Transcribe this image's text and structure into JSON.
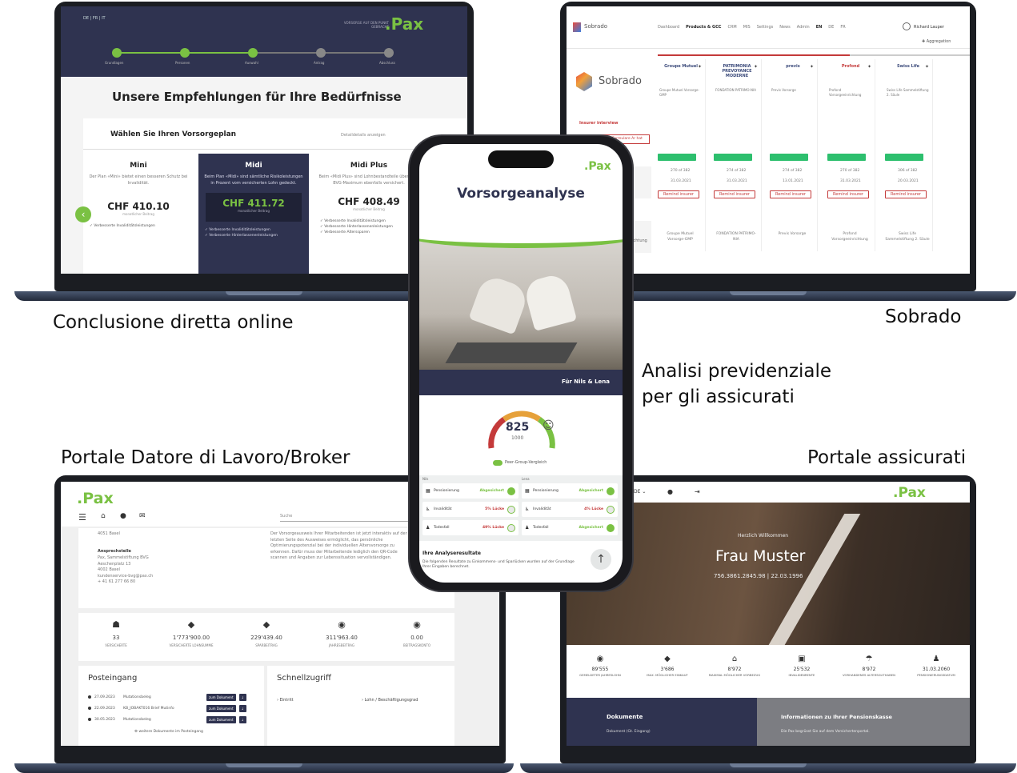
{
  "captions": {
    "top_left": "Conclusione diretta online",
    "top_right": "Sobrado",
    "middle": [
      "Analisi previdenziale",
      "per gli assicurati"
    ],
    "bottom_left": "Portale Datore di Lavoro/Broker",
    "bottom_right": "Portale assicurati"
  },
  "colors": {
    "navy": "#2f3350",
    "green": "#7ac143",
    "accent_green": "#2dbf6e",
    "red": "#c43a3a"
  },
  "pax_onboarding": {
    "logo": ".Pax",
    "lang": "DE | FR | IT",
    "tagline": "VORSORGE AUF DEN PUNKT GEBRACHT",
    "steps": [
      "Grundlagen",
      "Personen",
      "Auswahl",
      "Antrag",
      "Abschluss"
    ],
    "heading": "Unsere Empfehlungen für Ihre Bedürfnisse",
    "subheading": "Wählen Sie Ihren Vorsorgeplan",
    "compare_link": "Detaildetails anzeigen",
    "plans": [
      {
        "name": "Mini",
        "desc": "Der Plan «Mini» bietet einen besseren Schutz bei Invalidität.",
        "price": "CHF 410.10",
        "note": "monatlicher Beitrag",
        "features": [
          "Verbesserte Invaliditätsleistungen"
        ]
      },
      {
        "name": "Midi",
        "desc": "Beim Plan «Midi» sind sämtliche Risikoleistungen in Prozent vom versicherten Lohn gedeckt.",
        "price": "CHF 411.72",
        "note": "monatlicher Beitrag",
        "features": [
          "Verbesserte Invaliditätsleistungen",
          "Verbesserte Hinterlassenenleistungen"
        ]
      },
      {
        "name": "Midi Plus",
        "desc": "Beim «Midi Plus» sind Lohnbestandteile über dem BVG-Maximum ebenfalls versichert.",
        "price": "CHF 408.49",
        "note": "monatlicher Beitrag",
        "features": [
          "Verbesserte Invaliditätsleistungen",
          "Verbesserte Hinterlassenenleistungen",
          "Verbesserte Alterssparen"
        ]
      }
    ]
  },
  "sobrado": {
    "app_name": "Sobrado",
    "nav": [
      "Dashboard",
      "Products & GCC",
      "CRM",
      "MIS",
      "Settings",
      "News",
      "Admin"
    ],
    "langs": [
      "EN",
      "DE",
      "FR"
    ],
    "user": "Richard Lauper",
    "aggregation": "Aggregation",
    "section": "Insurer interview",
    "section_btn": "Formulare Ar hat",
    "insurers": [
      "Groupe Mutuel",
      "PATRIMONIA PREVOYANCE MODERNE",
      "previs",
      "Profond",
      "Swiss Life"
    ],
    "counts": [
      "270 of 382",
      "274 of 382",
      "274 of 382",
      "270 of 382",
      "306 of 382"
    ],
    "dates": [
      "31.03.2021",
      "31.03.2021",
      "13.01.2021",
      "31.03.2021",
      "20.03.2021"
    ],
    "remind": "Remind insurer",
    "foundations": [
      "Groupe Mutuel Vorsorge-GMP",
      "FONDATION PATRIMO-NIA",
      "Previs Vorsorge",
      "Profond Vorsorgeeinrichtung",
      "Swiss Life Sammelstiftung 2. Säule"
    ]
  },
  "phone": {
    "logo": ".Pax",
    "title": "Vorsorgeanalyse",
    "for": "Für Nils & Lena",
    "score": "825",
    "score_max": "1000",
    "peer": "Peer-Group-Vergleich",
    "persons": [
      "Nils",
      "Lena"
    ],
    "rows_left": [
      {
        "label": "Pensionierung",
        "status": "Abgesichert"
      },
      {
        "label": "Invalidität",
        "status": "5% Lücke"
      },
      {
        "label": "Todesfall",
        "status": "49% Lücke"
      }
    ],
    "rows_right": [
      {
        "label": "Pensionierung",
        "status": "Abgesichert"
      },
      {
        "label": "Invalidität",
        "status": "4% Lücke"
      },
      {
        "label": "Todesfall",
        "status": "Abgesichert"
      }
    ],
    "results_title": "Ihre Analyseresultate",
    "results_text": "Die folgenden Resultate zu Einkommens- und Sparlücken wurden auf der Grundlage Ihrer Eingaben berechnet."
  },
  "employer": {
    "logo": ".Pax",
    "search": "Suche",
    "address_top": "4051 Basel",
    "contact_title": "Ansprechstelle",
    "contact": [
      "Pax, Sammelstiftung BVG",
      "Aeschenplatz 13",
      "4002 Basel",
      "kundenservice-bvg@pax.ch",
      "+ 41 61 277 66 80"
    ],
    "info": "Der Vorsorgeausweis Ihrer Mitarbeitenden ist jetzt interaktiv auf der letzten Seite des Ausweises ermöglicht, das persönliche Optimierungspotenzial bei der individuellen Altersvorsorge zu erkennen. Dafür muss der Mitarbeitende lediglich den QR-Code scannen und Angaben zur Lebenssituation vervollständigen.",
    "stats": [
      {
        "value": "33",
        "label": "VERSICHERTE"
      },
      {
        "value": "1'773'900.00",
        "label": "VERSICHERTE LOHNSUMME"
      },
      {
        "value": "229'439.40",
        "label": "SPARBEITRAG"
      },
      {
        "value": "311'963.40",
        "label": "JAHRESBEITRAG"
      },
      {
        "value": "0.00",
        "label": "BEITRAGSKONTO"
      }
    ],
    "inbox_title": "Posteingang",
    "inbox": [
      {
        "date": "27.09.2023",
        "text": "Mutationsbeleg"
      },
      {
        "date": "22.09.2023",
        "text": "KB_JOBAKT016 Brief Mutinfo"
      },
      {
        "date": "30.05.2023",
        "text": "Mutationsbeleg"
      }
    ],
    "inbox_btn": "zum Dokument",
    "inbox_more": "weitere Dokumente im Posteingang",
    "quick_title": "Schnellzugriff",
    "quick": [
      "Eintritt",
      "Lohn / Beschäftigungsgrad"
    ]
  },
  "insured": {
    "logo": ".Pax",
    "lang": "DE",
    "welcome": "Herzlich Willkommen",
    "name": "Frau Muster",
    "id_line": "756.3861.2845.98 | 22.03.1996",
    "stats": [
      {
        "value": "89'555",
        "label": "GEMELDETER JAHRESLOHN"
      },
      {
        "value": "3'686",
        "label": "MAX. MÖGLICHER EINKAUF"
      },
      {
        "value": "8'972",
        "label": "MAXIMAL MÖGLICHER VORBEZUG"
      },
      {
        "value": "25'532",
        "label": "INVALIDENRENTE"
      },
      {
        "value": "8'972",
        "label": "VORHANDENES ALTERSGUTHABEN"
      },
      {
        "value": "31.03.2060",
        "label": "PENSIONIERUNGSDATUM"
      }
    ],
    "docs_title": "Dokumente",
    "docs_sub": "Dokument (Gt. Eingang)",
    "info_title": "Informationen zu Ihrer Pensionskasse",
    "info_text": "Die Pax begrüsst Sie auf dem Versichertenportal."
  }
}
